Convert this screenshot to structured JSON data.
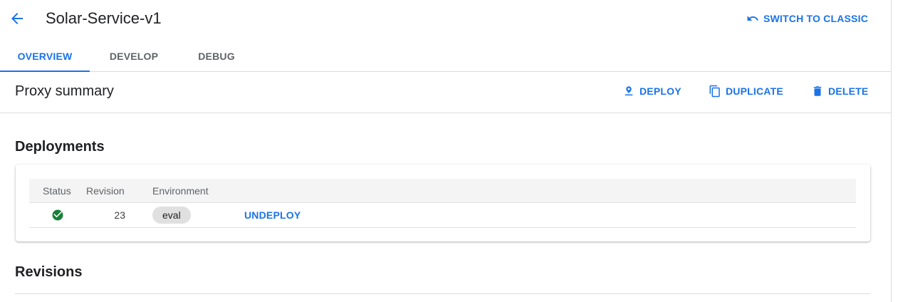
{
  "header": {
    "title": "Solar-Service-v1",
    "switch_label": "SWITCH TO CLASSIC"
  },
  "tabs": [
    {
      "label": "OVERVIEW",
      "active": true
    },
    {
      "label": "DEVELOP",
      "active": false
    },
    {
      "label": "DEBUG",
      "active": false
    }
  ],
  "summary": {
    "title": "Proxy summary",
    "actions": {
      "deploy": "DEPLOY",
      "duplicate": "DUPLICATE",
      "delete": "DELETE"
    }
  },
  "deployments": {
    "title": "Deployments",
    "columns": [
      "Status",
      "Revision",
      "Environment"
    ],
    "rows": [
      {
        "status": "deployed",
        "revision": "23",
        "environment": "eval",
        "action": "UNDEPLOY"
      }
    ]
  },
  "revisions": {
    "title": "Revisions"
  },
  "colors": {
    "accent": "#1a73e8",
    "success": "#188038",
    "chip": "#e0e0e0"
  },
  "icons": {
    "back": "arrow-back-icon",
    "switch": "undo-icon",
    "deploy": "pin-icon",
    "duplicate": "copy-icon",
    "delete": "trash-icon",
    "status": "check-circle-icon"
  }
}
